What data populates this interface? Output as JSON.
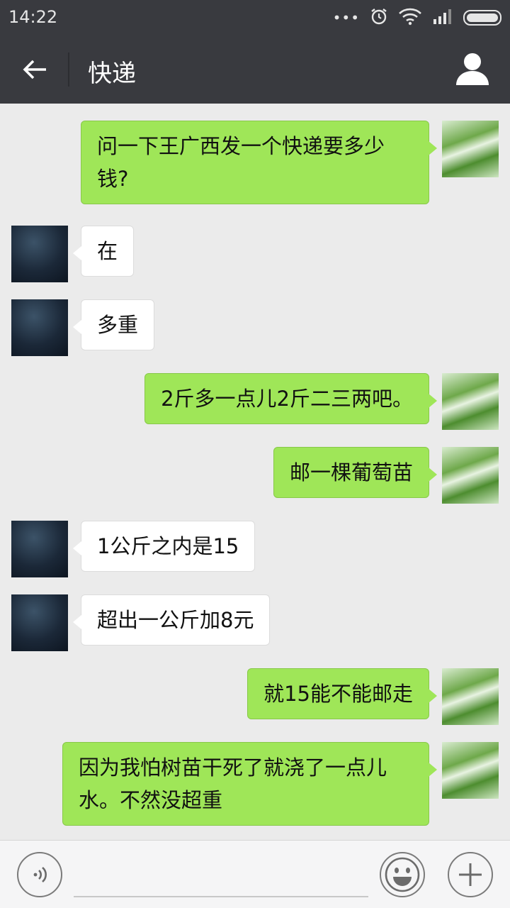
{
  "status_bar": {
    "time": "14:22",
    "icons": [
      "more-dots-icon",
      "alarm-icon",
      "wifi-icon",
      "signal-icon",
      "battery-icon"
    ]
  },
  "header": {
    "title": "快递",
    "back_icon": "arrow-left-icon",
    "profile_icon": "person-icon"
  },
  "messages": [
    {
      "from": "me",
      "text": "问一下王广西发一个快递要多少钱?"
    },
    {
      "from": "them",
      "text": "在"
    },
    {
      "from": "them",
      "text": "多重"
    },
    {
      "from": "me",
      "text": "2斤多一点儿2斤二三两吧。"
    },
    {
      "from": "me",
      "text": "邮一棵葡萄苗"
    },
    {
      "from": "them",
      "text": "1公斤之内是15"
    },
    {
      "from": "them",
      "text": "超出一公斤加8元"
    },
    {
      "from": "me",
      "text": "就15能不能邮走"
    },
    {
      "from": "me",
      "text": "因为我怕树苗干死了就浇了一点儿水。不然没超重"
    }
  ],
  "input_bar": {
    "value": "",
    "voice_icon": "voice-icon",
    "emoji_icon": "emoji-icon",
    "plus_icon": "plus-icon"
  },
  "colors": {
    "header_bg": "#393a3f",
    "chat_bg": "#ebebeb",
    "my_bubble": "#9fe658",
    "their_bubble": "#ffffff"
  }
}
